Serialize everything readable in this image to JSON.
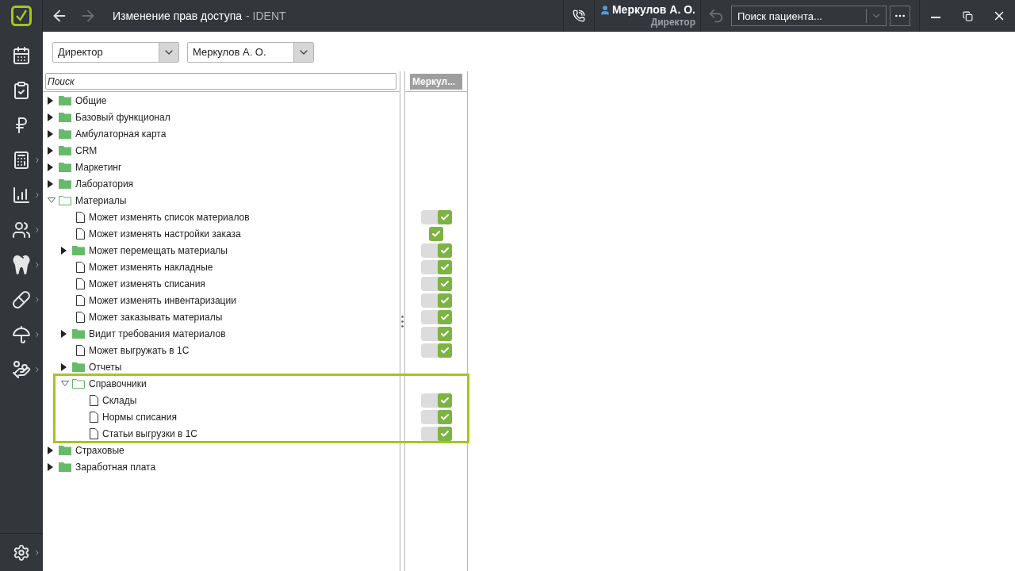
{
  "window": {
    "title": "Изменение прав доступа",
    "app": "- IDENT"
  },
  "nav": {
    "back_enabled": true,
    "forward_enabled": false
  },
  "user": {
    "name": "Меркулов А. О.",
    "role": "Директор"
  },
  "patient_search": {
    "placeholder": "Поиск пациента..."
  },
  "sidebar": {
    "items": [
      {
        "kind": "schedule",
        "submenu": false
      },
      {
        "kind": "tasks",
        "submenu": false
      },
      {
        "kind": "payments",
        "submenu": false
      },
      {
        "kind": "cashier",
        "submenu": true
      },
      {
        "kind": "reports",
        "submenu": true
      },
      {
        "kind": "people",
        "submenu": true
      },
      {
        "kind": "tooth",
        "submenu": true
      },
      {
        "kind": "materials",
        "submenu": true
      },
      {
        "kind": "insurance",
        "submenu": true
      },
      {
        "kind": "salary",
        "submenu": true
      }
    ],
    "settings": {
      "submenu": true
    }
  },
  "filters": [
    {
      "value": "Директор"
    },
    {
      "value": "Меркулов А. О."
    }
  ],
  "tree_search": {
    "placeholder": "Поиск"
  },
  "columns": [
    "Меркул..."
  ],
  "tree": [
    {
      "label": "Общие",
      "kind": "folder",
      "expanded": false,
      "highlighted": false
    },
    {
      "label": "Базовый функционал",
      "kind": "folder",
      "expanded": false,
      "highlighted": false
    },
    {
      "label": "Амбулаторная карта",
      "kind": "folder",
      "expanded": false,
      "highlighted": false
    },
    {
      "label": "CRM",
      "kind": "folder",
      "expanded": false,
      "highlighted": false
    },
    {
      "label": "Маркетинг",
      "kind": "folder",
      "expanded": false,
      "highlighted": false
    },
    {
      "label": "Лаборатория",
      "kind": "folder",
      "expanded": false,
      "highlighted": false
    },
    {
      "label": "Материалы",
      "kind": "folder",
      "expanded": true,
      "highlighted": false,
      "children": [
        {
          "label": "Может изменять список материалов",
          "kind": "item",
          "highlighted": false,
          "permission": {
            "kind": "switch",
            "checked": true
          }
        },
        {
          "label": "Может изменять настройки заказа",
          "kind": "item",
          "highlighted": false,
          "permission": {
            "kind": "check",
            "checked": true
          }
        },
        {
          "label": "Может перемещать материалы",
          "kind": "folder",
          "expanded": false,
          "highlighted": false,
          "permission": {
            "kind": "switch",
            "checked": true
          }
        },
        {
          "label": "Может изменять накладные",
          "kind": "item",
          "highlighted": false,
          "permission": {
            "kind": "switch",
            "checked": true
          }
        },
        {
          "label": "Может изменять списания",
          "kind": "item",
          "highlighted": false,
          "permission": {
            "kind": "switch",
            "checked": true
          }
        },
        {
          "label": "Может изменять инвентаризации",
          "kind": "item",
          "highlighted": false,
          "permission": {
            "kind": "switch",
            "checked": true
          }
        },
        {
          "label": "Может заказывать материалы",
          "kind": "item",
          "highlighted": false,
          "permission": {
            "kind": "switch",
            "checked": true
          }
        },
        {
          "label": "Видит требования материалов",
          "kind": "folder",
          "expanded": false,
          "highlighted": false,
          "permission": {
            "kind": "switch",
            "checked": true
          }
        },
        {
          "label": "Может выгружать в 1С",
          "kind": "item",
          "highlighted": false,
          "permission": {
            "kind": "switch",
            "checked": true
          }
        },
        {
          "label": "Отчеты",
          "kind": "folder",
          "expanded": false,
          "highlighted": false
        },
        {
          "label": "Справочники",
          "kind": "folder",
          "expanded": true,
          "highlighted": true,
          "children": [
            {
              "label": "Склады",
              "kind": "item",
              "highlighted": false,
              "permission": {
                "kind": "switch",
                "checked": true
              }
            },
            {
              "label": "Нормы списания",
              "kind": "item",
              "highlighted": false,
              "permission": {
                "kind": "switch",
                "checked": true
              }
            },
            {
              "label": "Статьи выгрузки в 1С",
              "kind": "item",
              "highlighted": false,
              "permission": {
                "kind": "switch",
                "checked": true
              }
            }
          ]
        }
      ]
    },
    {
      "label": "Страховые",
      "kind": "folder",
      "expanded": false,
      "highlighted": false
    },
    {
      "label": "Заработная плата",
      "kind": "folder",
      "expanded": false,
      "highlighted": false
    }
  ]
}
